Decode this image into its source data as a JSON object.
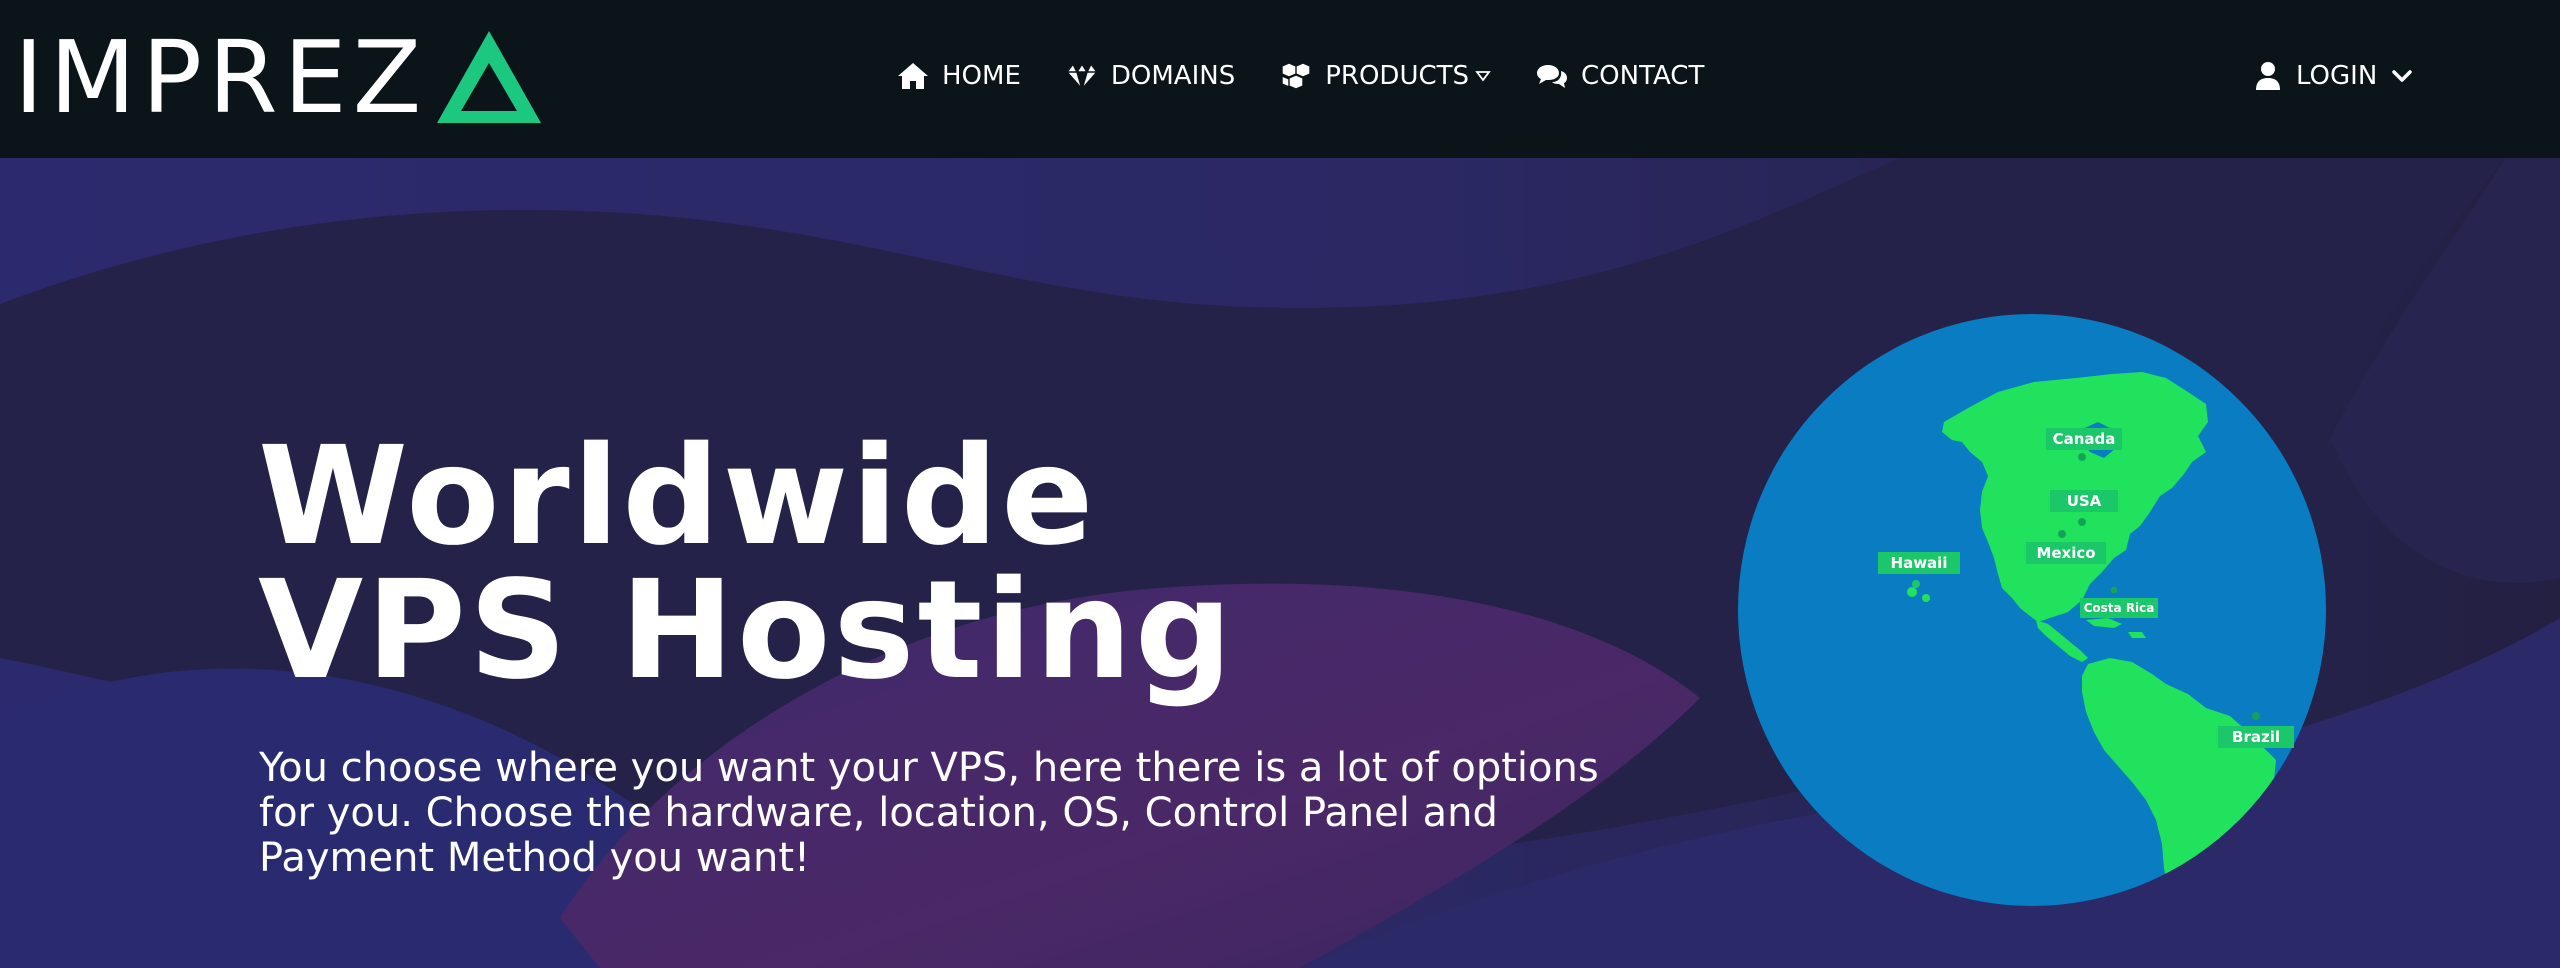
{
  "brand": {
    "name": "IMPREZ",
    "accent_color": "#1cc77f"
  },
  "nav": {
    "items": [
      {
        "label": "HOME",
        "icon": "home-icon"
      },
      {
        "label": "DOMAINS",
        "icon": "diamond-icon"
      },
      {
        "label": "PRODUCTS",
        "icon": "cubes-icon",
        "has_dropdown": true
      },
      {
        "label": "CONTACT",
        "icon": "comments-icon"
      }
    ],
    "login_label": "LOGIN"
  },
  "hero": {
    "title_line1": "Worldwide",
    "title_line2": "VPS Hosting",
    "subtitle": "You choose where you want your VPS, here there is a lot of options for you. Choose the hardware, location, OS, Control Panel and Payment Method you want!"
  },
  "globe": {
    "ocean_color": "#0a7cc2",
    "land_color": "#21e25c",
    "locations": [
      "Canada",
      "USA",
      "Hawaii",
      "Mexico",
      "Costa Rica",
      "Brazil"
    ]
  },
  "colors": {
    "navbar_bg": "#0a1419",
    "hero_bg": "#272561",
    "hero_wave_purple": "#4a2866"
  }
}
